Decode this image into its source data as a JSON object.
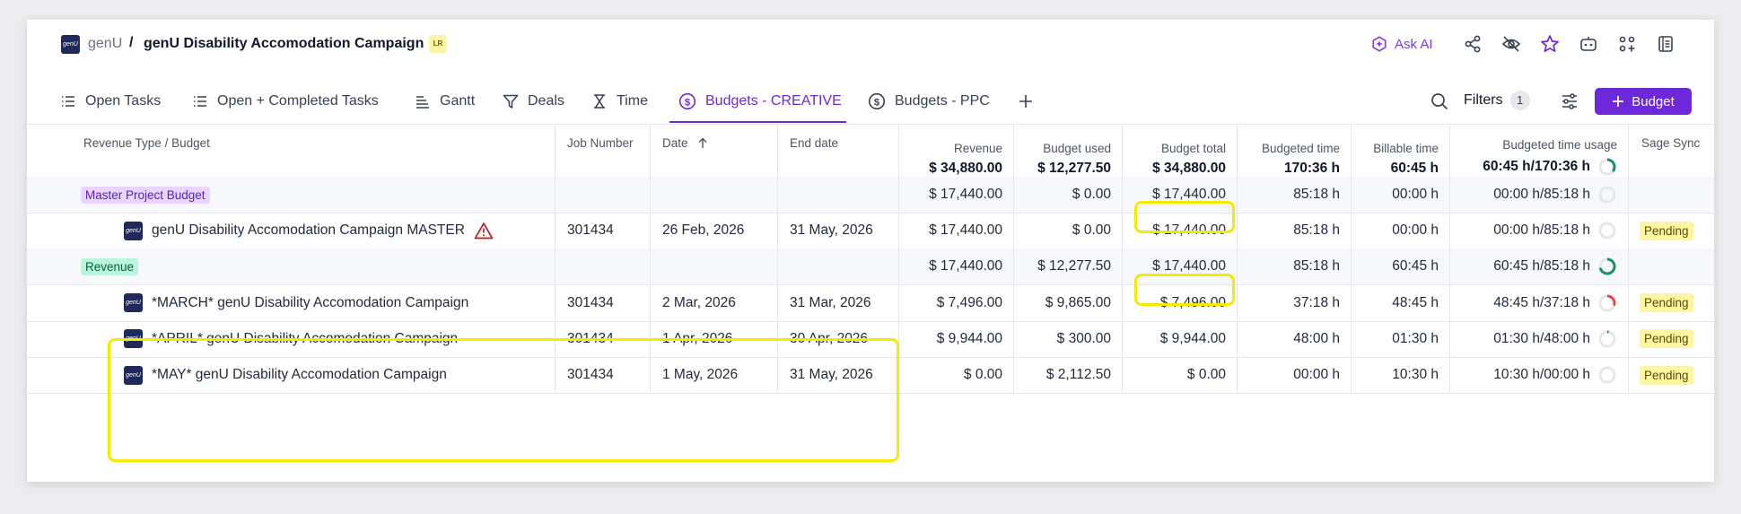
{
  "breadcrumb": {
    "root": "genU",
    "separator": "/",
    "title": "genU Disability Accomodation Campaign",
    "badge": "LR",
    "logo_text": "genU"
  },
  "header_actions": {
    "ask_ai": "Ask AI",
    "icons": [
      "share-icon",
      "eye-off-icon",
      "star-icon",
      "robot-icon",
      "apps-icon",
      "document-icon"
    ]
  },
  "tabs": [
    {
      "label": "Open Tasks",
      "icon": "list-icon",
      "active": false
    },
    {
      "label": "Open + Completed Tasks",
      "icon": "list-icon",
      "active": false
    },
    {
      "label": "Gantt",
      "icon": "gantt-icon",
      "active": false
    },
    {
      "label": "Deals",
      "icon": "funnel-icon",
      "active": false
    },
    {
      "label": "Time",
      "icon": "hourglass-icon",
      "active": false
    },
    {
      "label": "Budgets - CREATIVE",
      "icon": "dollar-circle-icon",
      "active": true
    },
    {
      "label": "Budgets - PPC",
      "icon": "dollar-circle-icon",
      "active": false
    }
  ],
  "toolbar": {
    "filters_label": "Filters",
    "filters_count": "1",
    "add_button": "Budget"
  },
  "columns": {
    "revenue_type": "Revenue Type / Budget",
    "job_number": "Job Number",
    "date": "Date",
    "end_date": "End date",
    "revenue": "Revenue",
    "budget_used": "Budget used",
    "budget_total": "Budget total",
    "budgeted_time": "Budgeted time",
    "billable_time": "Billable time",
    "budgeted_time_usage": "Budgeted time usage",
    "sage_sync": "Sage Sync"
  },
  "totals": {
    "revenue": "$ 34,880.00",
    "budget_used": "$ 12,277.50",
    "budget_total": "$ 34,880.00",
    "budgeted_time": "170:36 h",
    "billable_time": "60:45 h",
    "usage": "60:45 h/170:36 h",
    "usage_fraction": 0.356
  },
  "rows": [
    {
      "kind": "group",
      "name": "Master Project Budget",
      "tag_color": "#e9d5ff",
      "job": "",
      "date": "",
      "end": "",
      "revenue": "$ 17,440.00",
      "used": "$ 0.00",
      "total": "$ 17,440.00",
      "btime": "85:18 h",
      "bill": "00:00 h",
      "usage": "00:00 h/85:18 h",
      "usage_fraction": 0,
      "sage": ""
    },
    {
      "kind": "item",
      "name": "genU Disability Accomodation Campaign MASTER",
      "warning": true,
      "job": "301434",
      "date": "26 Feb, 2026",
      "end": "31 May, 2026",
      "revenue": "$ 17,440.00",
      "used": "$ 0.00",
      "total": "$ 17,440.00",
      "btime": "85:18 h",
      "bill": "00:00 h",
      "usage": "00:00 h/85:18 h",
      "usage_fraction": 0,
      "sage": "Pending"
    },
    {
      "kind": "group",
      "name": "Revenue",
      "tag_color": "#b9f4dc",
      "job": "",
      "date": "",
      "end": "",
      "revenue": "$ 17,440.00",
      "used": "$ 12,277.50",
      "total": "$ 17,440.00",
      "btime": "85:18 h",
      "bill": "60:45 h",
      "usage": "60:45 h/85:18 h",
      "usage_fraction": 0.712,
      "sage": ""
    },
    {
      "kind": "item",
      "name": "*MARCH* genU Disability Accomodation Campaign",
      "warning": false,
      "job": "301434",
      "date": "2 Mar, 2026",
      "end": "31 Mar, 2026",
      "revenue": "$ 7,496.00",
      "used": "$ 9,865.00",
      "total": "$ 7,496.00",
      "btime": "37:18 h",
      "bill": "48:45 h",
      "usage": "48:45 h/37:18 h",
      "usage_fraction": 0.3,
      "over": true,
      "sage": "Pending"
    },
    {
      "kind": "item",
      "name": "*APRIL* genU Disability Accomodation Campaign",
      "warning": false,
      "job": "301434",
      "date": "1 Apr, 2026",
      "end": "30 Apr, 2026",
      "revenue": "$ 9,944.00",
      "used": "$ 300.00",
      "total": "$ 9,944.00",
      "btime": "48:00 h",
      "bill": "01:30 h",
      "usage": "01:30 h/48:00 h",
      "usage_fraction": 0.031,
      "sage": "Pending"
    },
    {
      "kind": "item",
      "name": "*MAY* genU Disability Accomodation Campaign",
      "warning": false,
      "job": "301434",
      "date": "1 May, 2026",
      "end": "31 May, 2026",
      "revenue": "$ 0.00",
      "used": "$ 2,112.50",
      "total": "$ 0.00",
      "btime": "00:00 h",
      "bill": "10:30 h",
      "usage": "10:30 h/00:00 h",
      "usage_fraction": 0,
      "sage": "Pending"
    }
  ],
  "colors": {
    "accent": "#6d28d9",
    "highlight": "#f4eb00",
    "ring_green": "#15935f",
    "ring_red": "#ef4444",
    "ring_track": "#e5e7eb"
  }
}
